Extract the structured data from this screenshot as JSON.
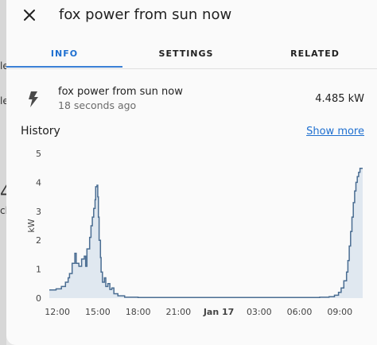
{
  "background": {
    "fragments": [
      "le",
      "le",
      "4",
      "cl"
    ]
  },
  "dialog": {
    "title": "fox power from sun now",
    "close_icon": "close-icon"
  },
  "tabs": [
    {
      "label": "INFO",
      "active": true
    },
    {
      "label": "SETTINGS",
      "active": false
    },
    {
      "label": "RELATED",
      "active": false
    }
  ],
  "entity": {
    "icon": "lightning-bolt-icon",
    "name": "fox power from sun now",
    "last_changed": "18 seconds ago",
    "state": "4.485 kW"
  },
  "history": {
    "title": "History",
    "show_more": "Show more"
  },
  "colors": {
    "accent": "#1e6fd0",
    "line": "#4a6d92",
    "fill": "#cfdcea"
  },
  "chart_data": {
    "type": "area",
    "ylabel": "kW",
    "ylim": [
      0,
      5
    ],
    "yticks": [
      0,
      1,
      2,
      3,
      4,
      5
    ],
    "x_tick_labels": [
      {
        "label": "12:00",
        "hour": 12,
        "bold": false
      },
      {
        "label": "15:00",
        "hour": 15,
        "bold": false
      },
      {
        "label": "18:00",
        "hour": 18,
        "bold": false
      },
      {
        "label": "21:00",
        "hour": 21,
        "bold": false
      },
      {
        "label": "Jan 17",
        "hour": 24,
        "bold": true
      },
      {
        "label": "03:00",
        "hour": 27,
        "bold": false
      },
      {
        "label": "06:00",
        "hour": 30,
        "bold": false
      },
      {
        "label": "09:00",
        "hour": 33,
        "bold": false
      }
    ],
    "xlim": [
      11.4,
      34.7
    ],
    "series": [
      {
        "points": [
          [
            11.4,
            0.28
          ],
          [
            11.9,
            0.32
          ],
          [
            12.3,
            0.4
          ],
          [
            12.6,
            0.55
          ],
          [
            12.8,
            0.7
          ],
          [
            12.9,
            0.85
          ],
          [
            13.1,
            1.2
          ],
          [
            13.3,
            1.55
          ],
          [
            13.4,
            1.2
          ],
          [
            13.6,
            1.1
          ],
          [
            13.8,
            1.35
          ],
          [
            14.0,
            1.45
          ],
          [
            14.1,
            1.1
          ],
          [
            14.2,
            1.7
          ],
          [
            14.4,
            2.1
          ],
          [
            14.5,
            2.5
          ],
          [
            14.6,
            2.8
          ],
          [
            14.7,
            3.1
          ],
          [
            14.8,
            3.4
          ],
          [
            14.85,
            3.85
          ],
          [
            14.95,
            3.9
          ],
          [
            15.0,
            3.5
          ],
          [
            15.05,
            2.8
          ],
          [
            15.1,
            2.0
          ],
          [
            15.2,
            1.4
          ],
          [
            15.25,
            0.9
          ],
          [
            15.35,
            0.55
          ],
          [
            15.5,
            0.7
          ],
          [
            15.6,
            0.4
          ],
          [
            15.75,
            0.5
          ],
          [
            15.9,
            0.3
          ],
          [
            16.05,
            0.35
          ],
          [
            16.2,
            0.15
          ],
          [
            16.5,
            0.08
          ],
          [
            17.0,
            0.03
          ],
          [
            18.0,
            0.02
          ],
          [
            20.0,
            0.02
          ],
          [
            22.0,
            0.02
          ],
          [
            24.0,
            0.02
          ],
          [
            26.0,
            0.02
          ],
          [
            28.0,
            0.02
          ],
          [
            30.0,
            0.02
          ],
          [
            31.5,
            0.03
          ],
          [
            32.2,
            0.05
          ],
          [
            32.6,
            0.1
          ],
          [
            32.9,
            0.2
          ],
          [
            33.1,
            0.35
          ],
          [
            33.3,
            0.6
          ],
          [
            33.5,
            0.9
          ],
          [
            33.6,
            1.3
          ],
          [
            33.7,
            1.8
          ],
          [
            33.8,
            2.3
          ],
          [
            33.9,
            2.8
          ],
          [
            34.0,
            3.3
          ],
          [
            34.1,
            3.7
          ],
          [
            34.2,
            4.0
          ],
          [
            34.3,
            4.2
          ],
          [
            34.4,
            4.35
          ],
          [
            34.5,
            4.485
          ],
          [
            34.7,
            4.485
          ]
        ]
      }
    ]
  }
}
